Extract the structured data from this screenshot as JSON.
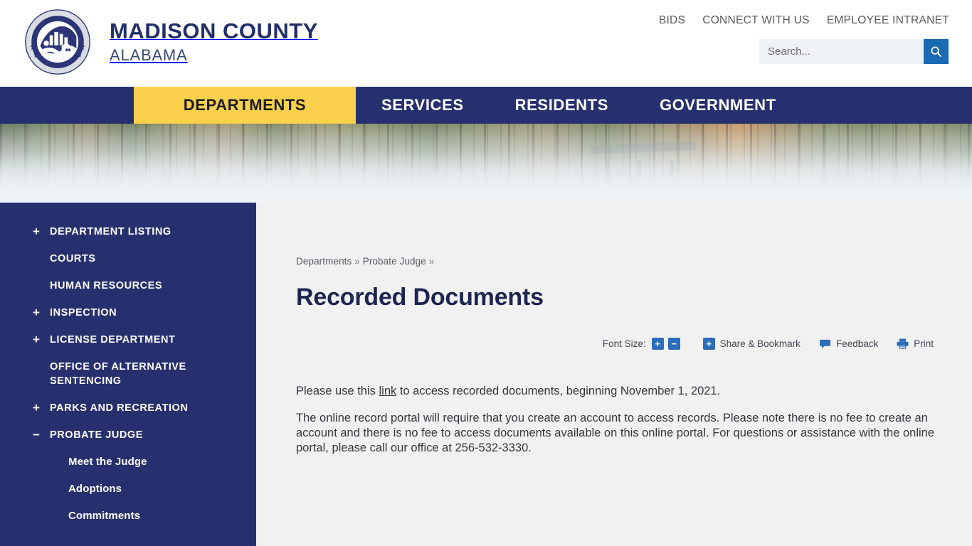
{
  "header": {
    "brand_title": "MADISON COUNTY",
    "brand_subtitle": "ALABAMA",
    "seal_outer_text_top": "MADISON COUNTY",
    "seal_outer_text_bottom": "ALABAMA",
    "utility_links": [
      {
        "label": "BIDS"
      },
      {
        "label": "CONNECT WITH US"
      },
      {
        "label": "EMPLOYEE INTRANET"
      }
    ],
    "search": {
      "placeholder": "Search...",
      "value": "",
      "button_icon": "search-icon"
    }
  },
  "mainnav": {
    "items": [
      {
        "label": "DEPARTMENTS",
        "active": true
      },
      {
        "label": "SERVICES",
        "active": false
      },
      {
        "label": "RESIDENTS",
        "active": false
      },
      {
        "label": "GOVERNMENT",
        "active": false
      }
    ],
    "active_bg": "#fbd04b",
    "bar_bg": "#27306e"
  },
  "banner": {
    "description": "foggy autumn forest and lake with covered bridge"
  },
  "sidebar": {
    "background": "#27306e",
    "items": [
      {
        "label": "DEPARTMENT LISTING",
        "toggle": "+",
        "level": 1
      },
      {
        "label": "COURTS",
        "toggle": "",
        "level": 1
      },
      {
        "label": "HUMAN RESOURCES",
        "toggle": "",
        "level": 1
      },
      {
        "label": "INSPECTION",
        "toggle": "+",
        "level": 1
      },
      {
        "label": "LICENSE DEPARTMENT",
        "toggle": "+",
        "level": 1
      },
      {
        "label": "OFFICE OF ALTERNATIVE SENTENCING",
        "toggle": "",
        "level": 1
      },
      {
        "label": "PARKS AND RECREATION",
        "toggle": "+",
        "level": 1
      },
      {
        "label": "PROBATE JUDGE",
        "toggle": "−",
        "level": 1
      },
      {
        "label": "Meet the Judge",
        "toggle": "",
        "level": 2
      },
      {
        "label": "Adoptions",
        "toggle": "",
        "level": 2
      },
      {
        "label": "Commitments",
        "toggle": "",
        "level": 2
      }
    ]
  },
  "content": {
    "breadcrumb": {
      "crumb1": "Departments",
      "sep1": "»",
      "crumb2": "Probate Judge",
      "sep2": "»"
    },
    "page_title": "Recorded Documents",
    "toolbar": {
      "font_size_label": "Font Size:",
      "increase_label": "+",
      "decrease_label": "−",
      "share_plus_label": "+",
      "share_label": "Share & Bookmark",
      "feedback_label": "Feedback",
      "print_label": "Print",
      "accent_color": "#2a6dbb"
    },
    "paragraphs": {
      "p1_before": "Please use this ",
      "p1_link": "link",
      "p1_after": " to access recorded documents, beginning November 1, 2021.",
      "p2": "The online record portal will require that you create an account to access records. Please note there is no fee to create an account and there is no fee to access documents available on this online portal. For questions or assistance with the online portal, please call our office at 256-532-3330."
    }
  }
}
